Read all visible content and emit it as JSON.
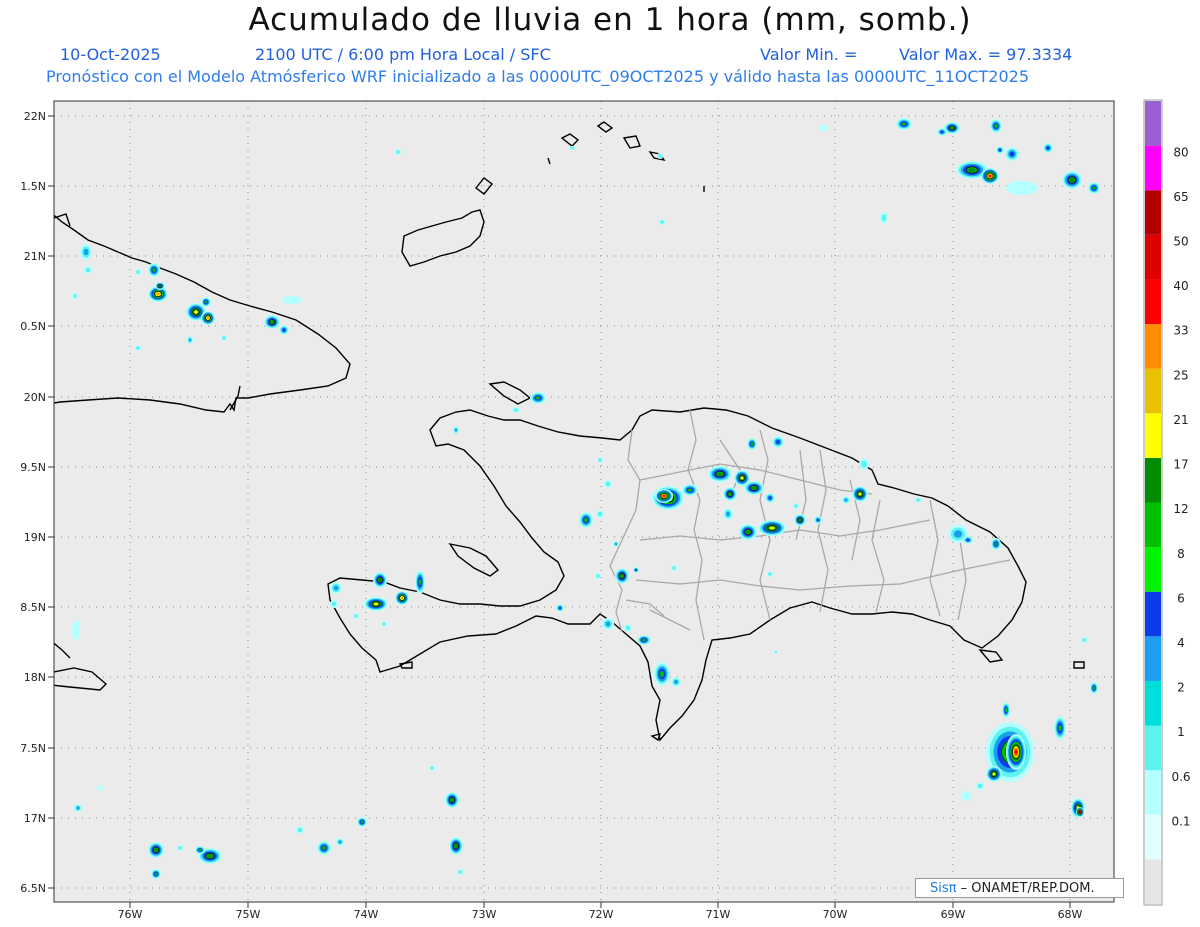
{
  "header": {
    "title": "Acumulado de lluvia en 1 hora (mm, somb.)",
    "date": "10-Oct-2025",
    "time_info": "2100 UTC / 6:00 pm Hora Local / SFC",
    "valor_min": "Valor Min. =",
    "valor_max": "Valor Max. = 97.3334",
    "forecast": "Pronóstico con el Modelo Atmósferico WRF inicializado a las 0000UTC_09OCT2025 y válido hasta las  0000UTC_11OCT2025"
  },
  "map": {
    "lat_ticks": [
      "22N",
      "1.5N",
      "21N",
      "0.5N",
      "20N",
      "9.5N",
      "19N",
      "8.5N",
      "18N",
      "7.5N",
      "17N",
      "6.5N"
    ],
    "lon_ticks": [
      "76W",
      "75W",
      "74W",
      "73W",
      "72W",
      "71W",
      "70W",
      "69W",
      "68W"
    ],
    "colors": {
      "background": "#ebebeb",
      "coast": "#000000",
      "provinces": "#a6a6a6",
      "grid": "#8a8a8a"
    }
  },
  "colorbar": {
    "levels": [
      {
        "label": "",
        "color": "#e6e6e6"
      },
      {
        "label": "0.1",
        "color": "#e1ffff"
      },
      {
        "label": "0.6",
        "color": "#b4ffff"
      },
      {
        "label": "1",
        "color": "#5cf3ef"
      },
      {
        "label": "2",
        "color": "#00dedc"
      },
      {
        "label": "4",
        "color": "#1d9ff0"
      },
      {
        "label": "6",
        "color": "#0b3ce8"
      },
      {
        "label": "8",
        "color": "#00f400"
      },
      {
        "label": "12",
        "color": "#00c000"
      },
      {
        "label": "17",
        "color": "#008b00"
      },
      {
        "label": "21",
        "color": "#ffff00"
      },
      {
        "label": "25",
        "color": "#e8c200"
      },
      {
        "label": "33",
        "color": "#ff8d00"
      },
      {
        "label": "40",
        "color": "#ff0000"
      },
      {
        "label": "50",
        "color": "#dd0000"
      },
      {
        "label": "65",
        "color": "#b20000"
      },
      {
        "label": "80",
        "color": "#ff00ff"
      },
      {
        "label": "",
        "color": "#9a5fd0"
      }
    ]
  },
  "credit": {
    "sis": "Sis",
    "pi": "π",
    "rest": " – ONAMET/REP.DOM."
  }
}
